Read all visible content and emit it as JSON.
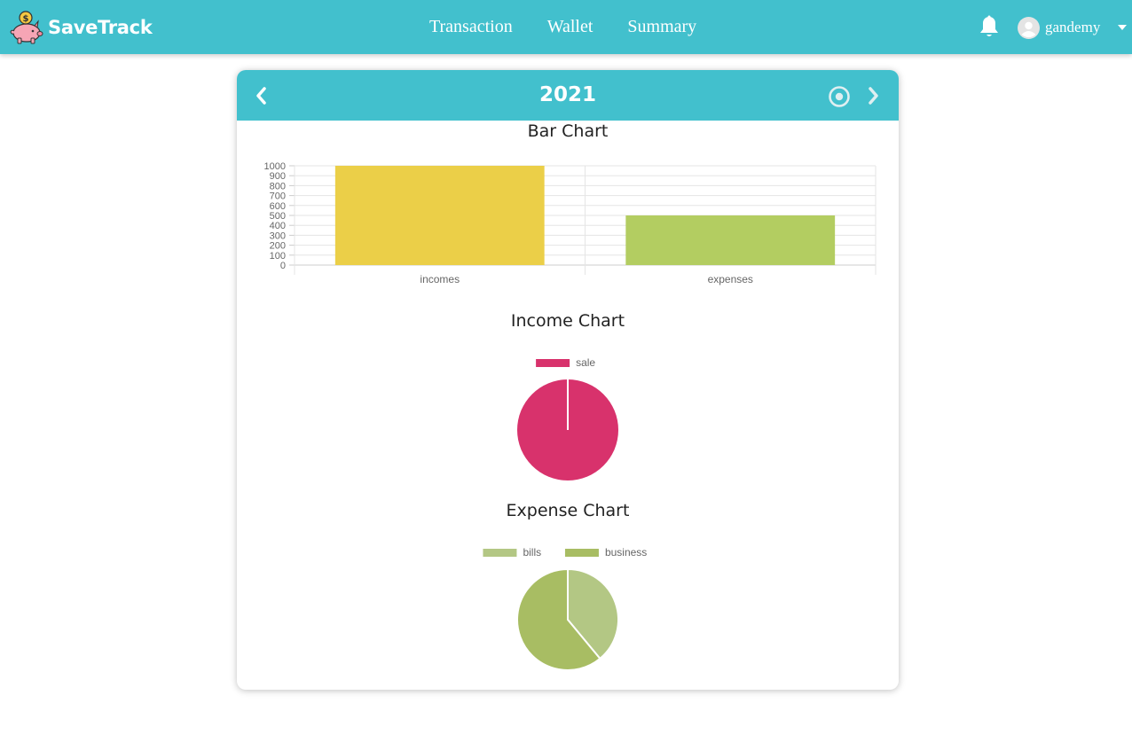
{
  "app": {
    "name": "SaveTrack"
  },
  "nav": {
    "links": [
      "Transaction",
      "Wallet",
      "Summary"
    ]
  },
  "user": {
    "name": "gandemy"
  },
  "icons": {
    "logo": "piggy-bank-icon",
    "notifications": "bell-icon",
    "avatar": "user-circle-icon",
    "prev": "chevron-left-icon",
    "today": "target-icon",
    "next": "chevron-right-icon",
    "menu": "caret-down-icon"
  },
  "colors": {
    "primary": "#42c0cd",
    "income_bar": "#ebcf48",
    "expense_bar": "#b3cd61",
    "sale": "#d8326c",
    "bills": "#b3c784",
    "business": "#a8bd63"
  },
  "summary": {
    "year": "2021"
  },
  "chart_data": [
    {
      "type": "bar",
      "title": "Bar Chart",
      "categories": [
        "incomes",
        "expenses"
      ],
      "values": [
        1000,
        500
      ],
      "ylim": [
        0,
        1000
      ],
      "yticks": [
        "1000",
        "900",
        "800",
        "700",
        "600",
        "500",
        "400",
        "300",
        "200",
        "100",
        "0"
      ],
      "grid": true
    },
    {
      "type": "pie",
      "title": "Income Chart",
      "labels": [
        "sale"
      ],
      "values": [
        100
      ],
      "legend": "top"
    },
    {
      "type": "pie",
      "title": "Expense Chart",
      "labels": [
        "bills",
        "business"
      ],
      "values": [
        39,
        61
      ],
      "legend": "top"
    }
  ]
}
